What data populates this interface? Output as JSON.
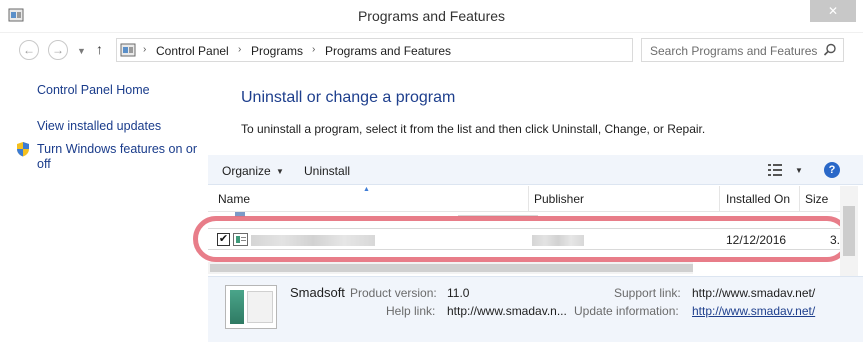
{
  "window": {
    "title": "Programs and Features",
    "close_glyph": "✕"
  },
  "nav": {
    "back_glyph": "←",
    "forward_glyph": "→",
    "dropdown_glyph": "▼",
    "up_glyph": "↑",
    "breadcrumb": [
      "Control Panel",
      "Programs",
      "Programs and Features"
    ],
    "breadcrumb_sep": "›",
    "refresh_glyph": "↻",
    "search_placeholder": "Search Programs and Features"
  },
  "sidebar": {
    "home": "Control Panel Home",
    "updates": "View installed updates",
    "features_line1": "Turn Windows features on or",
    "features_line2": "off"
  },
  "main": {
    "heading": "Uninstall or change a program",
    "description": "To uninstall a program, select it from the list and then click Uninstall, Change, or Repair."
  },
  "toolbar": {
    "organize": "Organize",
    "organize_caret": "▼",
    "uninstall": "Uninstall",
    "view_caret": "▼",
    "help": "?"
  },
  "columns": {
    "name": "Name",
    "publisher": "Publisher",
    "installed_on": "Installed On",
    "size": "Size",
    "sort_glyph": "▲"
  },
  "rows": [
    {
      "checked": "✔",
      "installed_on": "12/12/2016",
      "size": "3."
    }
  ],
  "details": {
    "name": "Smadsoft",
    "product_version_label": "Product version:",
    "product_version": "11.0",
    "help_link_label": "Help link:",
    "help_link": "http://www.smadav.n...",
    "support_link_label": "Support link:",
    "support_link": "http://www.smadav.net/",
    "update_info_label": "Update information:",
    "update_info": "http://www.smadav.net/"
  },
  "colors": {
    "accent": "#1e3f8d",
    "highlight": "#e56f7c",
    "toolbar_bg": "#f1f5fb"
  }
}
